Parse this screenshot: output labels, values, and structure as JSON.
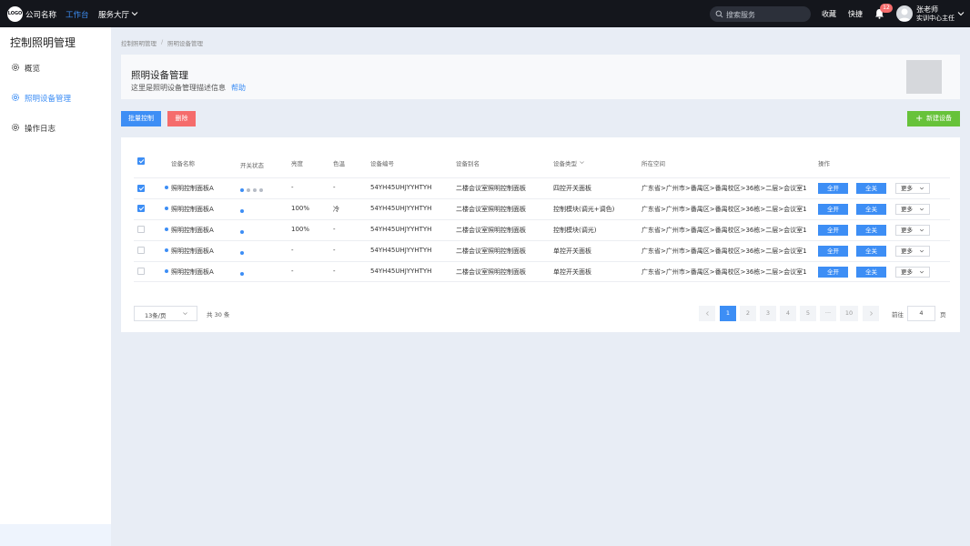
{
  "topbar": {
    "logo": "LOGO",
    "company": "公司名称",
    "nav": [
      "工作台",
      "服务大厅"
    ],
    "search_placeholder": "搜索服务",
    "favorites": "收藏",
    "shortcuts": "快捷",
    "notification_count": "12",
    "user_name": "张老师",
    "user_role": "实训中心主任",
    "accent_color": "#3d8ef5"
  },
  "sidebar": {
    "title": "控制照明管理",
    "items": [
      {
        "label": "概览",
        "icon": "gear-icon"
      },
      {
        "label": "照明设备管理",
        "icon": "gear-icon",
        "active": true
      },
      {
        "label": "操作日志",
        "icon": "gear-icon"
      }
    ]
  },
  "breadcrumb": [
    "控制照明管理",
    "照明设备管理"
  ],
  "header": {
    "title": "照明设备管理",
    "description": "这里是照明设备管理描述信息",
    "help": "帮助"
  },
  "toolbar": {
    "batch_control": "批量控制",
    "delete": "删除",
    "new_device": "新建设备"
  },
  "table": {
    "columns": [
      "设备名称",
      "开关状态",
      "亮度",
      "色温",
      "设备编号",
      "设备别名",
      "设备类型",
      "所在空间",
      "操作"
    ],
    "actions": {
      "on": "全开",
      "off": "全关",
      "more": "更多"
    },
    "rows": [
      {
        "checked": true,
        "name": "照明控制面板A",
        "status": "multi",
        "brightness": "-",
        "color_temp": "-",
        "code": "54YH45UHJYYHTYH",
        "alias": "二楼会议室照明控制面板",
        "type": "四控开关面板",
        "space": "广东省>广州市>番禺区>番禺校区>36栋>二层>会议室1"
      },
      {
        "checked": true,
        "name": "照明控制面板A",
        "status": "on",
        "brightness": "100%",
        "color_temp": "冷",
        "code": "54YH45UHJYYHTYH",
        "alias": "二楼会议室照明控制面板",
        "type": "控制模块(调光+调色)",
        "space": "广东省>广州市>番禺区>番禺校区>36栋>二层>会议室1"
      },
      {
        "checked": false,
        "name": "照明控制面板A",
        "status": "on",
        "brightness": "100%",
        "color_temp": "-",
        "code": "54YH45UHJYYHTYH",
        "alias": "二楼会议室照明控制面板",
        "type": "控制模块(调光)",
        "space": "广东省>广州市>番禺区>番禺校区>36栋>二层>会议室1"
      },
      {
        "checked": false,
        "name": "照明控制面板A",
        "status": "on",
        "brightness": "-",
        "color_temp": "-",
        "code": "54YH45UHJYYHTYH",
        "alias": "二楼会议室照明控制面板",
        "type": "单控开关面板",
        "space": "广东省>广州市>番禺区>番禺校区>36栋>二层>会议室1"
      },
      {
        "checked": false,
        "name": "照明控制面板A",
        "status": "on",
        "brightness": "-",
        "color_temp": "-",
        "code": "54YH45UHJYYHTYH",
        "alias": "二楼会议室照明控制面板",
        "type": "单控开关面板",
        "space": "广东省>广州市>番禺区>番禺校区>36栋>二层>会议室1"
      }
    ]
  },
  "pagination": {
    "page_size": "13条/页",
    "total": "共 30 条",
    "pages": [
      "1",
      "2",
      "3",
      "4",
      "5",
      "···",
      "10"
    ],
    "current": "1",
    "goto_label": "前往",
    "goto_value": "4",
    "page_unit": "页"
  }
}
